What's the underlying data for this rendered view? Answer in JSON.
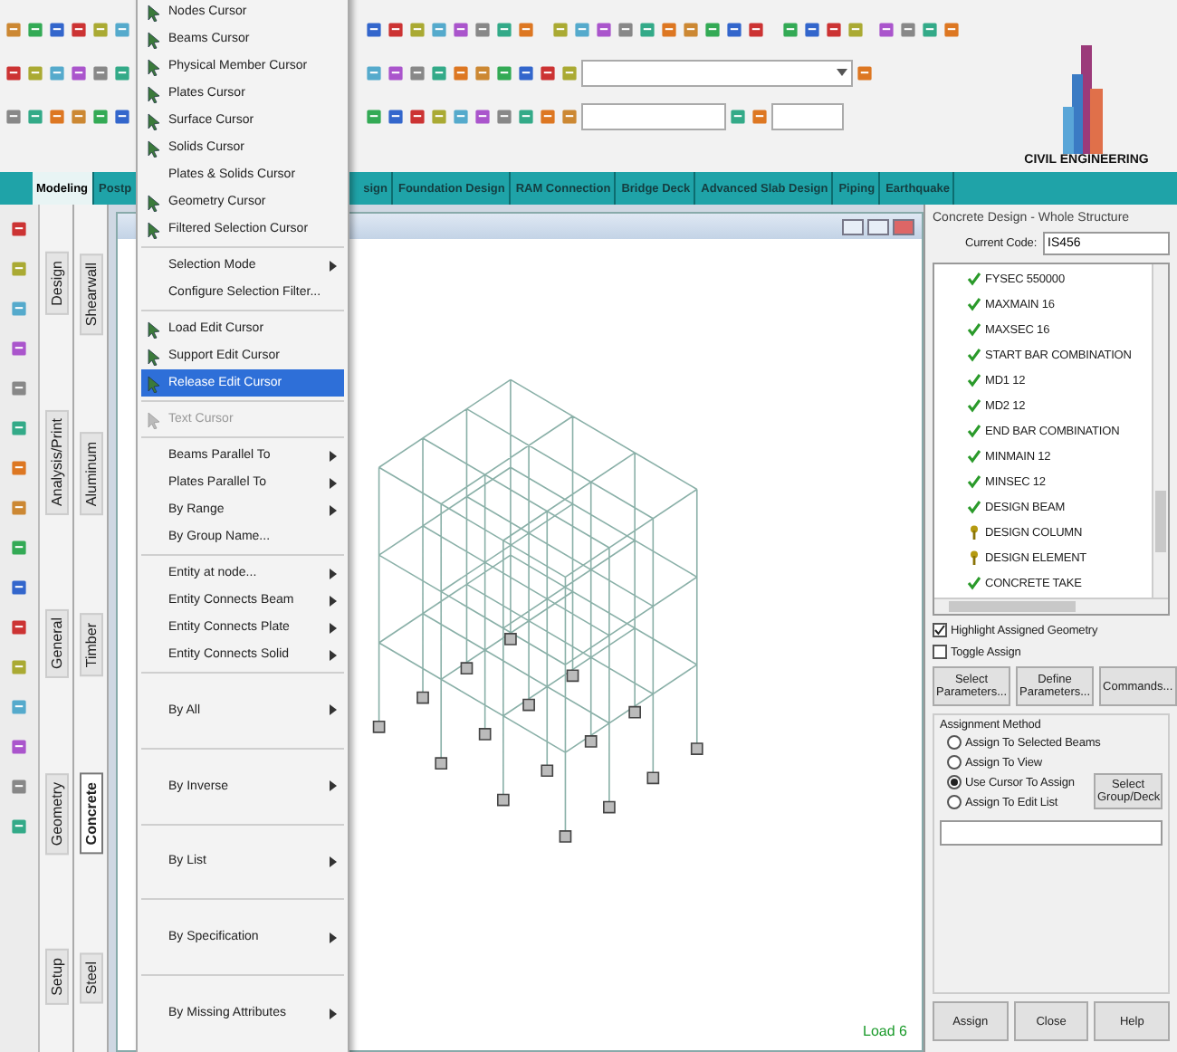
{
  "ribbon_tabs": [
    {
      "label": "Modeling",
      "selected": true
    },
    {
      "label": "Postp",
      "selected": false
    },
    {
      "label": "sign",
      "selected": false
    },
    {
      "label": "Foundation Design",
      "selected": false
    },
    {
      "label": "RAM Connection",
      "selected": false
    },
    {
      "label": "Bridge Deck",
      "selected": false
    },
    {
      "label": "Advanced Slab Design",
      "selected": false
    },
    {
      "label": "Piping",
      "selected": false
    },
    {
      "label": "Earthquake",
      "selected": false
    }
  ],
  "logo": {
    "text": "CIVIL ENGINEERING"
  },
  "side_tabs": [
    {
      "label": "Design",
      "selected": false
    },
    {
      "label": "Analysis/Print",
      "selected": false
    },
    {
      "label": "General",
      "selected": false
    },
    {
      "label": "Geometry",
      "selected": false
    },
    {
      "label": "Setup",
      "selected": false
    }
  ],
  "design_tabs": [
    {
      "label": "Shearwall",
      "selected": false
    },
    {
      "label": "Aluminum",
      "selected": false
    },
    {
      "label": "Timber",
      "selected": false
    },
    {
      "label": "Concrete",
      "selected": true
    },
    {
      "label": "Steel",
      "selected": false
    }
  ],
  "viewport": {
    "load_label": "Load 6"
  },
  "menu": {
    "groups": [
      {
        "items": [
          {
            "label": "Nodes Cursor",
            "icon": true,
            "submenu": false,
            "disabled": false,
            "selected": false
          },
          {
            "label": "Beams Cursor",
            "icon": true,
            "submenu": false,
            "disabled": false,
            "selected": false
          },
          {
            "label": "Physical Member Cursor",
            "icon": true,
            "submenu": false,
            "disabled": false,
            "selected": false
          },
          {
            "label": "Plates Cursor",
            "icon": true,
            "submenu": false,
            "disabled": false,
            "selected": false
          },
          {
            "label": "Surface Cursor",
            "icon": true,
            "submenu": false,
            "disabled": false,
            "selected": false
          },
          {
            "label": "Solids Cursor",
            "icon": true,
            "submenu": false,
            "disabled": false,
            "selected": false
          },
          {
            "label": "Plates & Solids Cursor",
            "icon": false,
            "submenu": false,
            "disabled": false,
            "selected": false
          },
          {
            "label": "Geometry Cursor",
            "icon": true,
            "submenu": false,
            "disabled": false,
            "selected": false
          },
          {
            "label": "Filtered Selection Cursor",
            "icon": true,
            "submenu": false,
            "disabled": false,
            "selected": false
          }
        ]
      },
      {
        "items": [
          {
            "label": "Selection Mode",
            "icon": false,
            "submenu": true,
            "disabled": false,
            "selected": false
          },
          {
            "label": "Configure Selection Filter...",
            "icon": false,
            "submenu": false,
            "disabled": false,
            "selected": false
          }
        ]
      },
      {
        "items": [
          {
            "label": "Load Edit Cursor",
            "icon": true,
            "submenu": false,
            "disabled": false,
            "selected": false
          },
          {
            "label": "Support Edit Cursor",
            "icon": true,
            "submenu": false,
            "disabled": false,
            "selected": false
          },
          {
            "label": "Release Edit Cursor",
            "icon": true,
            "submenu": false,
            "disabled": false,
            "selected": true
          }
        ]
      },
      {
        "items": [
          {
            "label": "Text Cursor",
            "icon": true,
            "submenu": false,
            "disabled": true,
            "selected": false
          }
        ]
      },
      {
        "items": [
          {
            "label": "Beams Parallel To",
            "icon": false,
            "submenu": true,
            "disabled": false,
            "selected": false
          },
          {
            "label": "Plates Parallel To",
            "icon": false,
            "submenu": true,
            "disabled": false,
            "selected": false
          },
          {
            "label": "By Range",
            "icon": false,
            "submenu": true,
            "disabled": false,
            "selected": false
          },
          {
            "label": "By Group Name...",
            "icon": false,
            "submenu": false,
            "disabled": false,
            "selected": false
          }
        ]
      },
      {
        "items": [
          {
            "label": "Entity at node...",
            "icon": false,
            "submenu": true,
            "disabled": false,
            "selected": false
          },
          {
            "label": "Entity Connects Beam",
            "icon": false,
            "submenu": true,
            "disabled": false,
            "selected": false
          },
          {
            "label": "Entity Connects Plate",
            "icon": false,
            "submenu": true,
            "disabled": false,
            "selected": false
          },
          {
            "label": "Entity Connects Solid",
            "icon": false,
            "submenu": true,
            "disabled": false,
            "selected": false
          }
        ]
      },
      {
        "items": [
          {
            "label": "By All",
            "icon": false,
            "submenu": true,
            "disabled": false,
            "selected": false
          }
        ]
      },
      {
        "items": [
          {
            "label": "By Inverse",
            "icon": false,
            "submenu": true,
            "disabled": false,
            "selected": false
          }
        ]
      },
      {
        "items": [
          {
            "label": "By List",
            "icon": false,
            "submenu": true,
            "disabled": false,
            "selected": false
          }
        ]
      },
      {
        "items": [
          {
            "label": "By Specification",
            "icon": false,
            "submenu": true,
            "disabled": false,
            "selected": false
          }
        ]
      },
      {
        "items": [
          {
            "label": "By Missing Attributes",
            "icon": false,
            "submenu": true,
            "disabled": false,
            "selected": false
          }
        ]
      }
    ]
  },
  "design_panel": {
    "title": "Concrete Design - Whole Structure",
    "code_label": "Current Code:",
    "code_value": "IS456",
    "commands": [
      {
        "label": "FYSEC 550000",
        "kind": "done"
      },
      {
        "label": "MAXMAIN 16",
        "kind": "done"
      },
      {
        "label": "MAXSEC 16",
        "kind": "done"
      },
      {
        "label": "START BAR COMBINATION",
        "kind": "done"
      },
      {
        "label": "MD1 12",
        "kind": "done"
      },
      {
        "label": "MD2 12",
        "kind": "done"
      },
      {
        "label": "END BAR COMBINATION",
        "kind": "done"
      },
      {
        "label": "MINMAIN 12",
        "kind": "done"
      },
      {
        "label": "MINSEC 12",
        "kind": "done"
      },
      {
        "label": "DESIGN BEAM",
        "kind": "done"
      },
      {
        "label": "DESIGN COLUMN",
        "kind": "pending"
      },
      {
        "label": "DESIGN ELEMENT",
        "kind": "pending"
      },
      {
        "label": "CONCRETE TAKE",
        "kind": "done"
      }
    ],
    "checkboxes": [
      {
        "label": "Highlight Assigned Geometry",
        "checked": true
      },
      {
        "label": "Toggle Assign",
        "checked": false
      }
    ],
    "buttons": [
      "Select Parameters...",
      "Define Parameters...",
      "Commands..."
    ],
    "method_label": "Assignment Method",
    "methods": [
      {
        "label": "Assign To Selected Beams",
        "selected": false
      },
      {
        "label": "Assign To View",
        "selected": false
      },
      {
        "label": "Use Cursor To Assign",
        "selected": true
      },
      {
        "label": "Assign To Edit List",
        "selected": false
      }
    ],
    "group_button": "Select Group/Deck",
    "footer_buttons": [
      "Assign",
      "Close",
      "Help"
    ]
  }
}
